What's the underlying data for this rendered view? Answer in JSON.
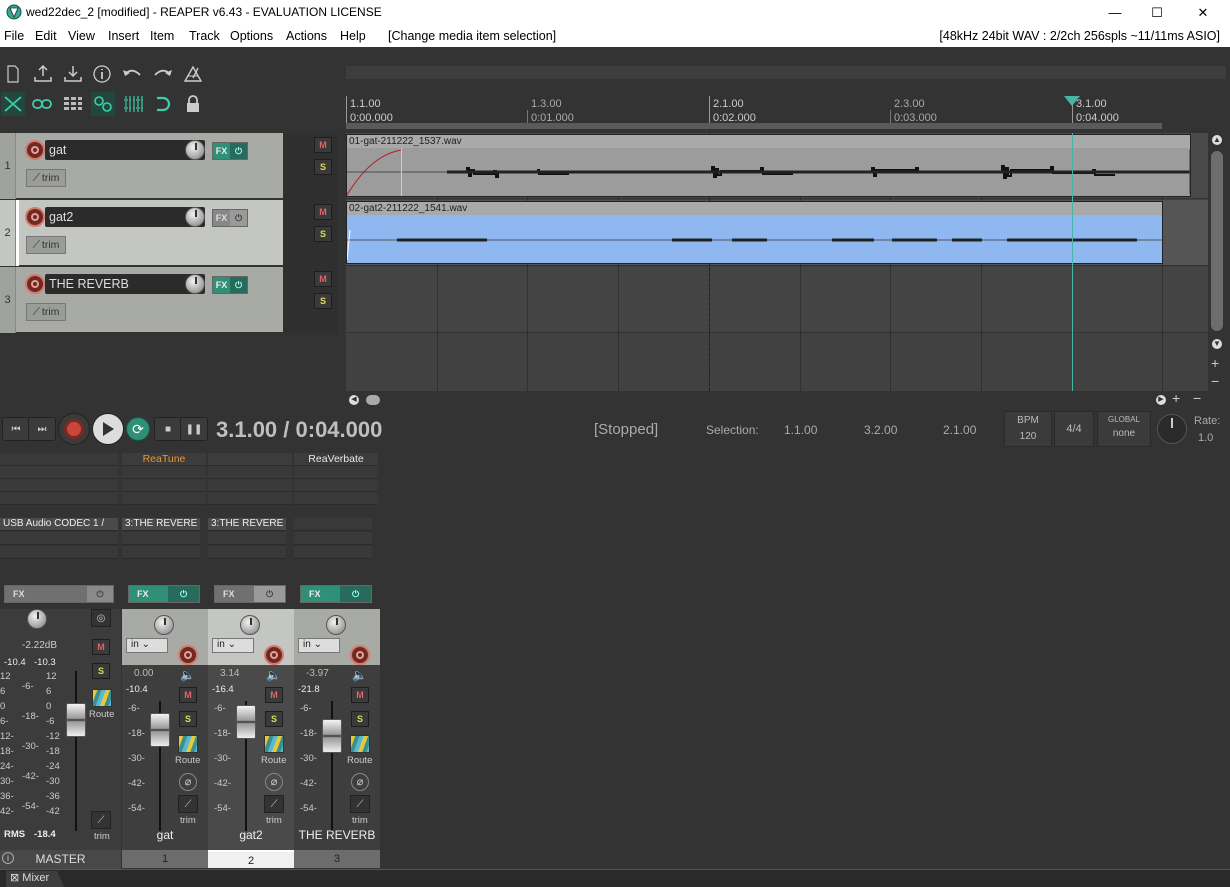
{
  "window": {
    "title": "wed22dec_2 [modified] - REAPER v6.43 - EVALUATION LICENSE",
    "minimize": "—",
    "maximize": "☐",
    "close": "✕"
  },
  "menu": {
    "items": [
      "File",
      "Edit",
      "View",
      "Insert",
      "Item",
      "Track",
      "Options",
      "Actions",
      "Help"
    ],
    "action_hint": "[Change media item selection]",
    "status": "[48kHz 24bit WAV : 2/2ch 256spls ~11/11ms ASIO]"
  },
  "ruler": {
    "marks": [
      {
        "bar": "1.1.00",
        "time": "0:00.000"
      },
      {
        "bar": "1.3.00",
        "time": "0:01.000"
      },
      {
        "bar": "2.1.00",
        "time": "0:02.000"
      },
      {
        "bar": "2.3.00",
        "time": "0:03.000"
      },
      {
        "bar": "3.1.00",
        "time": "0:04.000"
      }
    ]
  },
  "tracks": [
    {
      "num": "1",
      "name": "gat",
      "fx": "FX",
      "trim": "trim",
      "mute": "M",
      "solo": "S"
    },
    {
      "num": "2",
      "name": "gat2",
      "fx": "FX",
      "trim": "trim",
      "mute": "M",
      "solo": "S"
    },
    {
      "num": "3",
      "name": "THE REVERB",
      "fx": "FX",
      "trim": "trim",
      "mute": "M",
      "solo": "S"
    }
  ],
  "items": [
    {
      "name": "01-gat-211222_1537.wav"
    },
    {
      "name": "02-gat2-211222_1541.wav"
    }
  ],
  "transport": {
    "position": "3.1.00 / 0:04.000",
    "state": "[Stopped]",
    "selection_label": "Selection:",
    "sel_start": "1.1.00",
    "sel_end": "3.2.00",
    "sel_len": "2.1.00",
    "bpm_label": "BPM",
    "bpm": "120",
    "timesig": "4/4",
    "global_label": "GLOBAL",
    "global_value": "none",
    "rate_label": "Rate:",
    "rate": "1.0"
  },
  "mixer": {
    "master": {
      "input": "USB Audio CODEC 1 /",
      "fx": "FX",
      "volume": "-2.22dB",
      "peak_l": "-10.4",
      "peak_r": "-10.3",
      "rms_label": "RMS",
      "rms": "-18.4",
      "mute": "M",
      "solo": "S",
      "route": "Route",
      "trim": "trim",
      "label": "MASTER",
      "ticks_left": [
        "12",
        "6",
        "0",
        "6-",
        "12-",
        "18-",
        "24-",
        "30-",
        "36-",
        "42-"
      ],
      "ticks_mid": [
        "-6-",
        "-18-",
        "-30-",
        "-42-",
        "-54-"
      ],
      "ticks_right": [
        "12",
        "6",
        "0",
        "-6",
        "-12",
        "-18",
        "-24",
        "-30",
        "-36",
        "-42"
      ]
    },
    "strips": [
      {
        "fx_header": "ReaTune",
        "send": "3:THE REVERE",
        "fx": "FX",
        "input": "in",
        "volume": "0.00",
        "peak": "-10.4",
        "name": "gat",
        "num": "1",
        "mute": "M",
        "solo": "S",
        "route": "Route",
        "trim": "trim",
        "ticks": [
          "-6-",
          "-18-",
          "-30-",
          "-42-",
          "-54-"
        ]
      },
      {
        "fx_header": "",
        "send": "3:THE REVERE",
        "fx": "FX",
        "input": "in",
        "volume": "3.14",
        "peak": "-16.4",
        "name": "gat2",
        "num": "2",
        "mute": "M",
        "solo": "S",
        "route": "Route",
        "trim": "trim",
        "ticks": [
          "-6-",
          "-18-",
          "-30-",
          "-42-",
          "-54-"
        ]
      },
      {
        "fx_header": "ReaVerbate",
        "send": "",
        "fx": "FX",
        "input": "in",
        "volume": "-3.97",
        "peak": "-21.8",
        "name": "THE REVERB",
        "num": "3",
        "mute": "M",
        "solo": "S",
        "route": "Route",
        "trim": "trim",
        "ticks": [
          "-6-",
          "-18-",
          "-30-",
          "-42-",
          "-54-"
        ]
      }
    ]
  },
  "bottom": {
    "mixer_tab": "Mixer",
    "info_icon": "i"
  },
  "colors": {
    "accent": "#2f8f77",
    "item_blue": "#8fb8f0",
    "item_gray": "#a9a9a9",
    "edit_cursor": "#48b4a8"
  }
}
